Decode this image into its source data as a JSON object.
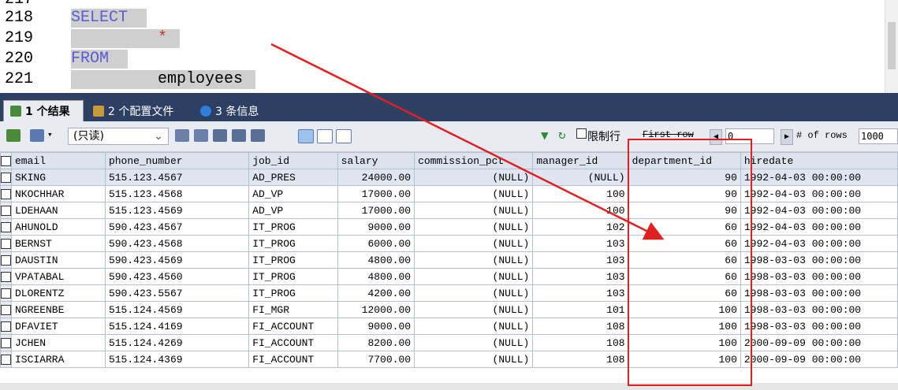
{
  "editor": {
    "lines": [
      {
        "num": "217",
        "code": ""
      },
      {
        "num": "218",
        "code": "SELECT"
      },
      {
        "num": "219",
        "code": "*"
      },
      {
        "num": "220",
        "code": "FROM"
      },
      {
        "num": "221",
        "code": "employees"
      }
    ]
  },
  "tabs": [
    {
      "label": "1 个结果"
    },
    {
      "label": "2 个配置文件"
    },
    {
      "label": "3 条信息"
    }
  ],
  "toolbar": {
    "readonly_select": "(只读)",
    "limit_label": "限制行",
    "first_row_label": "First row",
    "first_row_value": "0",
    "rows_label": "# of rows",
    "rows_value": "1000"
  },
  "table": {
    "columns": [
      "email",
      "phone_number",
      "job_id",
      "salary",
      "commission_pct",
      "manager_id",
      "department_id",
      "hiredate"
    ],
    "rows": [
      [
        "SKING",
        "515.123.4567",
        "AD_PRES",
        "24000.00",
        "(NULL)",
        "(NULL)",
        "90",
        "1992-04-03 00:00:00"
      ],
      [
        "NKOCHHAR",
        "515.123.4568",
        "AD_VP",
        "17000.00",
        "(NULL)",
        "100",
        "90",
        "1992-04-03 00:00:00"
      ],
      [
        "LDEHAAN",
        "515.123.4569",
        "AD_VP",
        "17000.00",
        "(NULL)",
        "100",
        "90",
        "1992-04-03 00:00:00"
      ],
      [
        "AHUNOLD",
        "590.423.4567",
        "IT_PROG",
        "9000.00",
        "(NULL)",
        "102",
        "60",
        "1992-04-03 00:00:00"
      ],
      [
        "BERNST",
        "590.423.4568",
        "IT_PROG",
        "6000.00",
        "(NULL)",
        "103",
        "60",
        "1992-04-03 00:00:00"
      ],
      [
        "DAUSTIN",
        "590.423.4569",
        "IT_PROG",
        "4800.00",
        "(NULL)",
        "103",
        "60",
        "1998-03-03 00:00:00"
      ],
      [
        "VPATABAL",
        "590.423.4560",
        "IT_PROG",
        "4800.00",
        "(NULL)",
        "103",
        "60",
        "1998-03-03 00:00:00"
      ],
      [
        "DLORENTZ",
        "590.423.5567",
        "IT_PROG",
        "4200.00",
        "(NULL)",
        "103",
        "60",
        "1998-03-03 00:00:00"
      ],
      [
        "NGREENBE",
        "515.124.4569",
        "FI_MGR",
        "12000.00",
        "(NULL)",
        "101",
        "100",
        "1998-03-03 00:00:00"
      ],
      [
        "DFAVIET",
        "515.124.4169",
        "FI_ACCOUNT",
        "9000.00",
        "(NULL)",
        "108",
        "100",
        "1998-03-03 00:00:00"
      ],
      [
        "JCHEN",
        "515.124.4269",
        "FI_ACCOUNT",
        "8200.00",
        "(NULL)",
        "108",
        "100",
        "2000-09-09 00:00:00"
      ],
      [
        "ISCIARRA",
        "515.124.4369",
        "FI_ACCOUNT",
        "7700.00",
        "(NULL)",
        "108",
        "100",
        "2000-09-09 00:00:00"
      ]
    ]
  },
  "colors": {
    "annotation": "#e02020",
    "keyword": "#5b5bd6",
    "tabbar": "#2d3f63"
  }
}
